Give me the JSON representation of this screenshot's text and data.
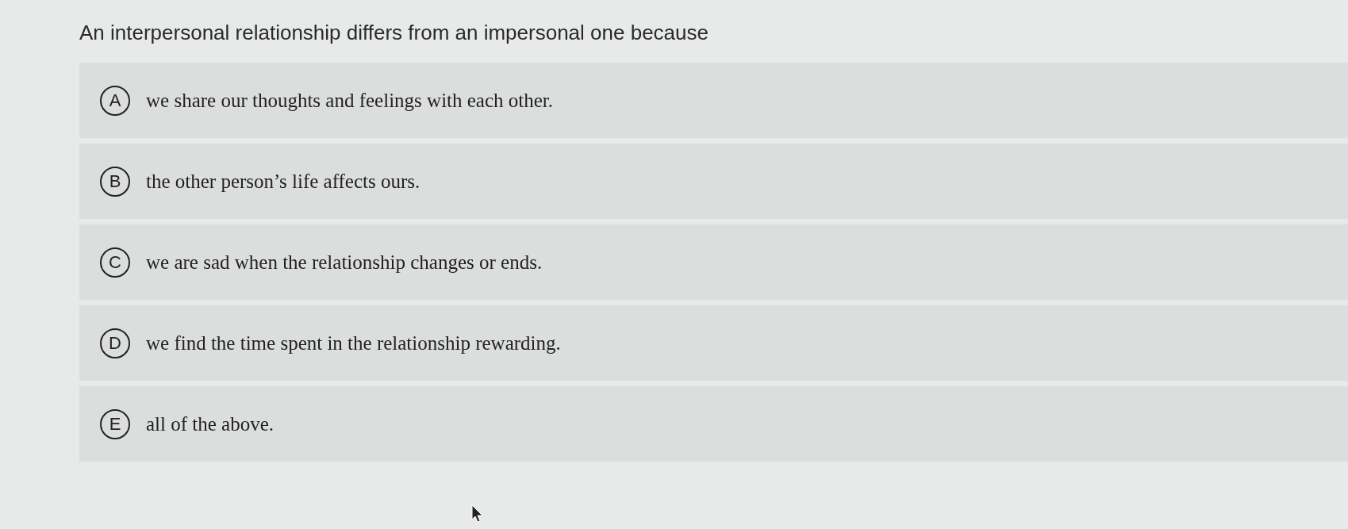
{
  "question": "An interpersonal relationship differs from an impersonal one because",
  "options": [
    {
      "letter": "A",
      "text": "we share our thoughts and feelings with each other."
    },
    {
      "letter": "B",
      "text": "the other person’s life affects ours."
    },
    {
      "letter": "C",
      "text": "we are sad when the relationship changes or ends."
    },
    {
      "letter": "D",
      "text": "we find the time spent in the relationship rewarding."
    },
    {
      "letter": "E",
      "text": "all of the above."
    }
  ]
}
